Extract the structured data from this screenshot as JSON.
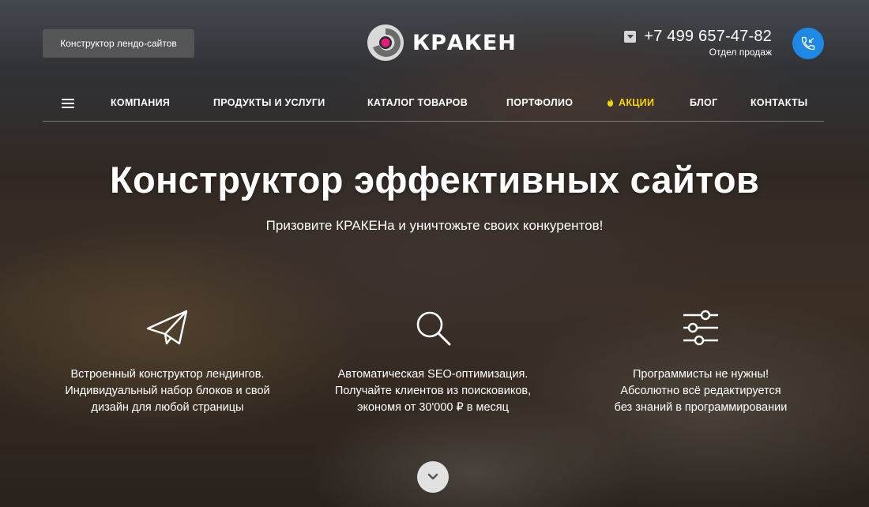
{
  "header": {
    "builder_button": "Конструктор лендо-сайтов",
    "logo_text": "КРАКЕН",
    "phone_number": "+7 499 657-47-82",
    "phone_caption": "Отдел продаж",
    "call_icon": "phone-call-icon",
    "accent_color": "#1e88e5"
  },
  "nav": {
    "menu_icon": "hamburger-icon",
    "items": [
      {
        "label": "КОМПАНИЯ"
      },
      {
        "label": "ПРОДУКТЫ И УСЛУГИ"
      },
      {
        "label": "КАТАЛОГ ТОВАРОВ"
      },
      {
        "label": "ПОРТФОЛИО"
      },
      {
        "label": "АКЦИИ",
        "icon": "fire-icon",
        "color": "#f5d400"
      },
      {
        "label": "БЛОГ"
      },
      {
        "label": "КОНТАКТЫ"
      }
    ]
  },
  "hero": {
    "title": "Конструктор эффективных сайтов",
    "subtitle": "Призовите КРАКЕНа и уничтожьте своих конкурентов!"
  },
  "features": [
    {
      "icon": "paper-plane-icon",
      "lines": [
        "Встроенный конструктор лендингов.",
        "Индивидуальный набор блоков и свой",
        "дизайн для любой страницы"
      ]
    },
    {
      "icon": "search-icon",
      "lines": [
        "Автоматическая SEO-оптимизация.",
        "Получайте клиентов из поисковиков,",
        "экономя от 30'000 ₽ в месяц"
      ]
    },
    {
      "icon": "sliders-icon",
      "lines": [
        "Программисты не нужны!",
        "Абсолютно всё редактируется",
        "без знаний в программировании"
      ]
    }
  ],
  "scroll_icon": "chevron-down-icon"
}
